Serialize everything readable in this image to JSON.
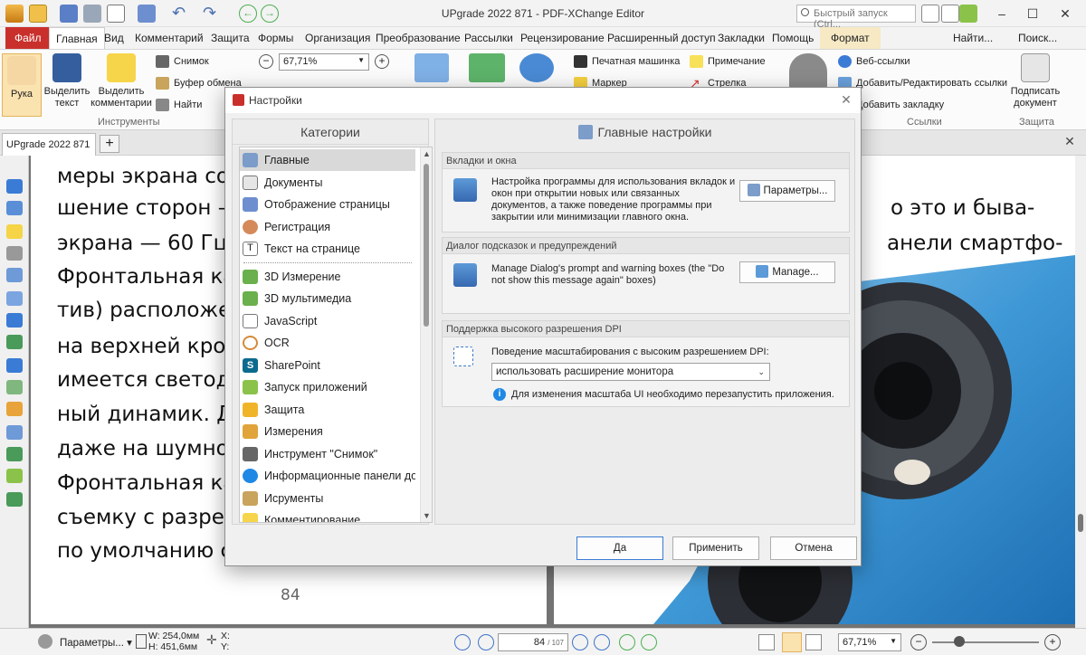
{
  "window": {
    "title": "UPgrade 2022 871 - PDF-XChange Editor",
    "quick_launch_placeholder": "Быстрый запуск (Ctrl..."
  },
  "menu": {
    "file": "Файл",
    "tabs": [
      "Главная",
      "Вид",
      "Комментарий",
      "Защита",
      "Формы",
      "Организация",
      "Преобразование",
      "Рассылки",
      "Рецензирование",
      "Расширенный доступ",
      "Закладки",
      "Помощь",
      "Формат"
    ],
    "find": "Найти...",
    "search": "Поиск..."
  },
  "ribbon": {
    "hand": "Рука",
    "select_text": "Выделить текст",
    "select_comments": "Выделить комментарии",
    "tools_group": "Инструменты",
    "snapshot": "Снимок",
    "clipboard": "Буфер обмена",
    "find": "Найти",
    "zoom": "67,71%",
    "typewriter": "Печатная машинка",
    "marker": "Маркер",
    "note": "Примечание",
    "arrow": "Стрелка",
    "web_links": "Веб-ссылки",
    "add_edit_links": "Добавить/Редактировать ссылки",
    "add_bookmark": "Добавить закладку",
    "links_group": "Ссылки",
    "sign_doc": "Подписать документ",
    "protect_group": "Защита"
  },
  "doc": {
    "tab_name": "UPgrade 2022 871",
    "left_lines": [
      "меры экрана сост",
      "шение сторон —",
      "экрана — 60 Гц.",
      "Фронтальная кам",
      "тив) расположена",
      "на верхней кромк",
      "имеется светоди",
      "ный динамик. Ди",
      "даже на шумной",
      "Фронтальная кам",
      "съемку с разреш",
      "по умолчанию ст"
    ],
    "right_lines": [
      "о это и быва-",
      "анели смартфо-"
    ],
    "page_number": "84"
  },
  "status": {
    "settings": "Параметры...",
    "w": "W: 254,0мм",
    "h": "H: 451,6мм",
    "x": "X:",
    "y": "Y:",
    "page_current": "84",
    "page_total": "/ 107",
    "zoom": "67,71%"
  },
  "dialog": {
    "title": "Настройки",
    "categories_header": "Категории",
    "categories": [
      "Главные",
      "Документы",
      "Отображение страницы",
      "Регистрация",
      "Текст на странице",
      "3D Измерение",
      "3D мультимедиа",
      "JavaScript",
      "OCR",
      "SharePoint",
      "Запуск приложений",
      "Защита",
      "Измерения",
      "Инструмент \"Снимок\"",
      "Информационные панели до",
      "Исрументы",
      "Комментирование"
    ],
    "settings_header": "Главные настройки",
    "sections": {
      "tabs": {
        "title": "Вкладки и окна",
        "text": "Настройка программы для использования вкладок и окон при открытии новых или связанных документов, а также поведение программы при закрытии или минимизации главного окна.",
        "button": "Параметры..."
      },
      "prompts": {
        "title": "Диалог подсказок и предупреждений",
        "text": "Manage Dialog's prompt and warning boxes (the \"Do not show this message again\" boxes)",
        "button": "Manage..."
      },
      "dpi": {
        "title": "Поддержка высокого разрешения DPI",
        "label": "Поведение масштабирования с высоким разрешением DPI:",
        "select_value": "использовать расширение монитора",
        "info": "Для изменения масштаба UI необходимо перезапустить приложения."
      }
    },
    "buttons": {
      "ok": "Да",
      "apply": "Применить",
      "cancel": "Отмена"
    }
  }
}
